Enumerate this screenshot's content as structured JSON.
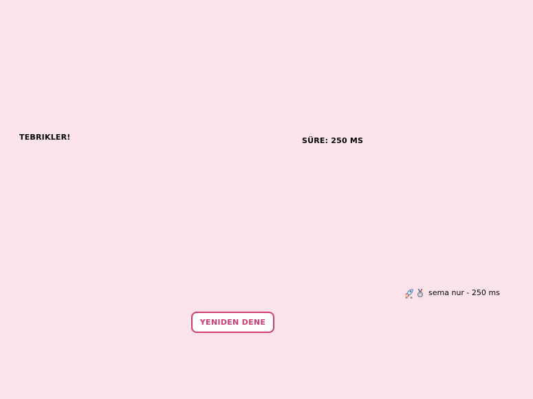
{
  "result": {
    "congrats_label": "Tebrikler!",
    "time_label": "Süre: 250 ms"
  },
  "leaderboard": {
    "entries": [
      {
        "icons": [
          "rocket-icon",
          "medal-icon"
        ],
        "text": "sema nur - 250 ms"
      }
    ],
    "trailing_text": "\" \""
  },
  "actions": {
    "retry_label": "Yeniden Dene"
  },
  "colors": {
    "background": "#fde4ea",
    "accent": "#d63a6e"
  }
}
